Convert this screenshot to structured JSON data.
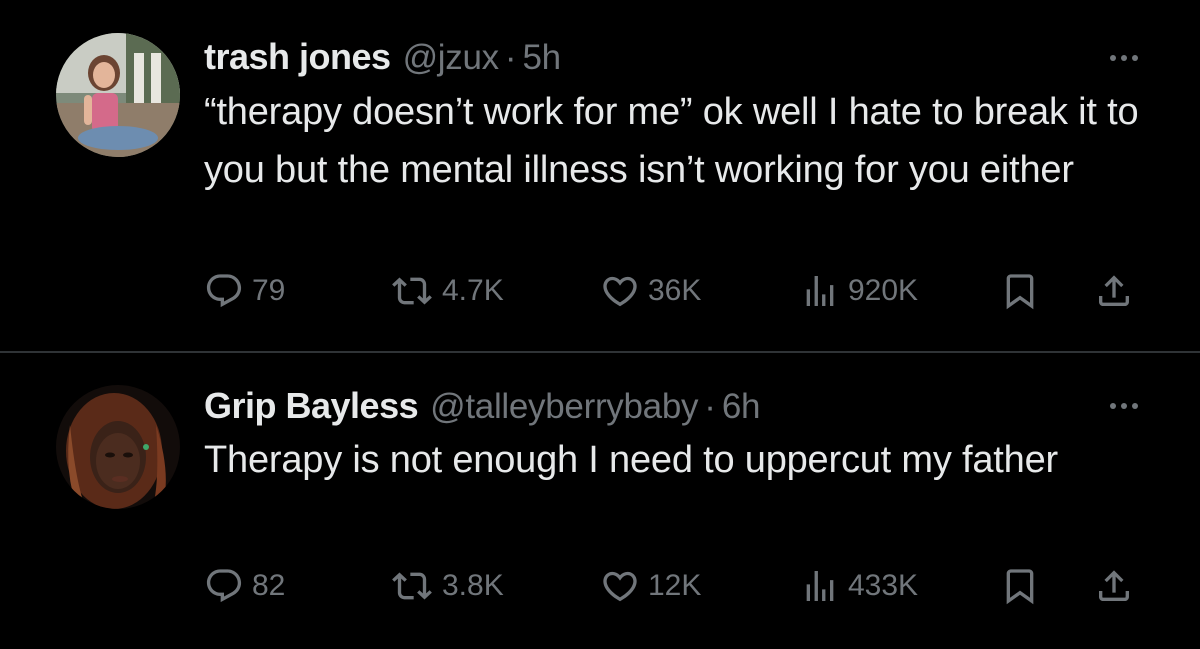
{
  "tweets": [
    {
      "name": "trash jones",
      "handle": "@jzux",
      "separator": "·",
      "time": "5h",
      "text": "“therapy doesn’t work for me” ok well I hate to break it to you but the mental illness isn’t working for you either",
      "replies": "79",
      "retweets": "4.7K",
      "likes": "36K",
      "views": "920K"
    },
    {
      "name": "Grip Bayless",
      "handle": "@talleyberrybaby",
      "separator": "·",
      "time": "6h",
      "text": "Therapy is not enough I need to uppercut my father",
      "replies": "82",
      "retweets": "3.8K",
      "likes": "12K",
      "views": "433K"
    }
  ],
  "icons": {
    "reply": "speech-bubble",
    "retweet": "repeat-arrows",
    "like": "heart",
    "views": "bar-chart",
    "bookmark": "bookmark",
    "share": "upload-arrow",
    "more": "three-dots"
  },
  "colors": {
    "background": "#000000",
    "text": "#e7e9ea",
    "secondary": "#71767b",
    "divider": "#2f3336"
  }
}
